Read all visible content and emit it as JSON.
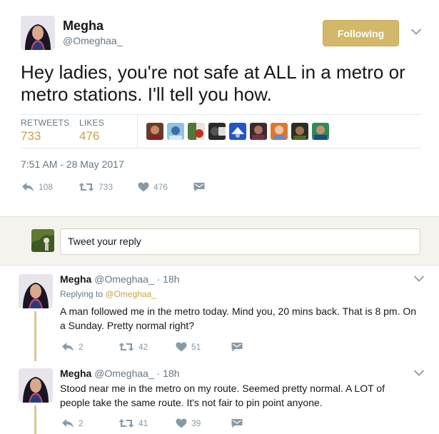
{
  "main_tweet": {
    "author_name": "Megha",
    "author_handle": "@Omeghaa_",
    "follow_label": "Following",
    "text": "Hey ladies, you're not safe at ALL in a metro or metro stations. I'll tell you how.",
    "retweets_label": "RETWEETS",
    "retweets_count": "733",
    "likes_label": "LIKES",
    "likes_count": "476",
    "timestamp": "7:51 AM - 28 May 2017",
    "reply_count": "108",
    "retweet_count": "733",
    "like_count": "476"
  },
  "reply_box": {
    "placeholder": "Tweet your reply"
  },
  "replies": [
    {
      "author_name": "Megha",
      "author_handle": "@Omeghaa_",
      "separator": "·",
      "age": "18h",
      "replying_prefix": "Replying to",
      "replying_handle": "@Omeghaa_",
      "text": "A man followed me in the metro today. Mind you, 20 mins back. That is 8 pm. On a Sunday. Pretty normal right?",
      "reply_count": "2",
      "retweet_count": "42",
      "like_count": "51"
    },
    {
      "author_name": "Megha",
      "author_handle": "@Omeghaa_",
      "separator": "·",
      "age": "18h",
      "text": "Stood near me in the metro on my route. Seemed pretty normal. A LOT of people take the same route. It's not fair to pin point anyone.",
      "reply_count": "2",
      "retweet_count": "41",
      "like_count": "39"
    }
  ],
  "colors": {
    "accent": "#c8a24a",
    "follow_button": "#d4b86a",
    "thread_line": "#d9c58f",
    "muted_text": "#657786",
    "action_icon": "#8899a6"
  },
  "icons": {
    "reply": "reply-arrow-icon",
    "retweet": "retweet-icon",
    "like": "heart-icon",
    "dm": "direct-message-icon",
    "more": "chevron-down-icon"
  }
}
